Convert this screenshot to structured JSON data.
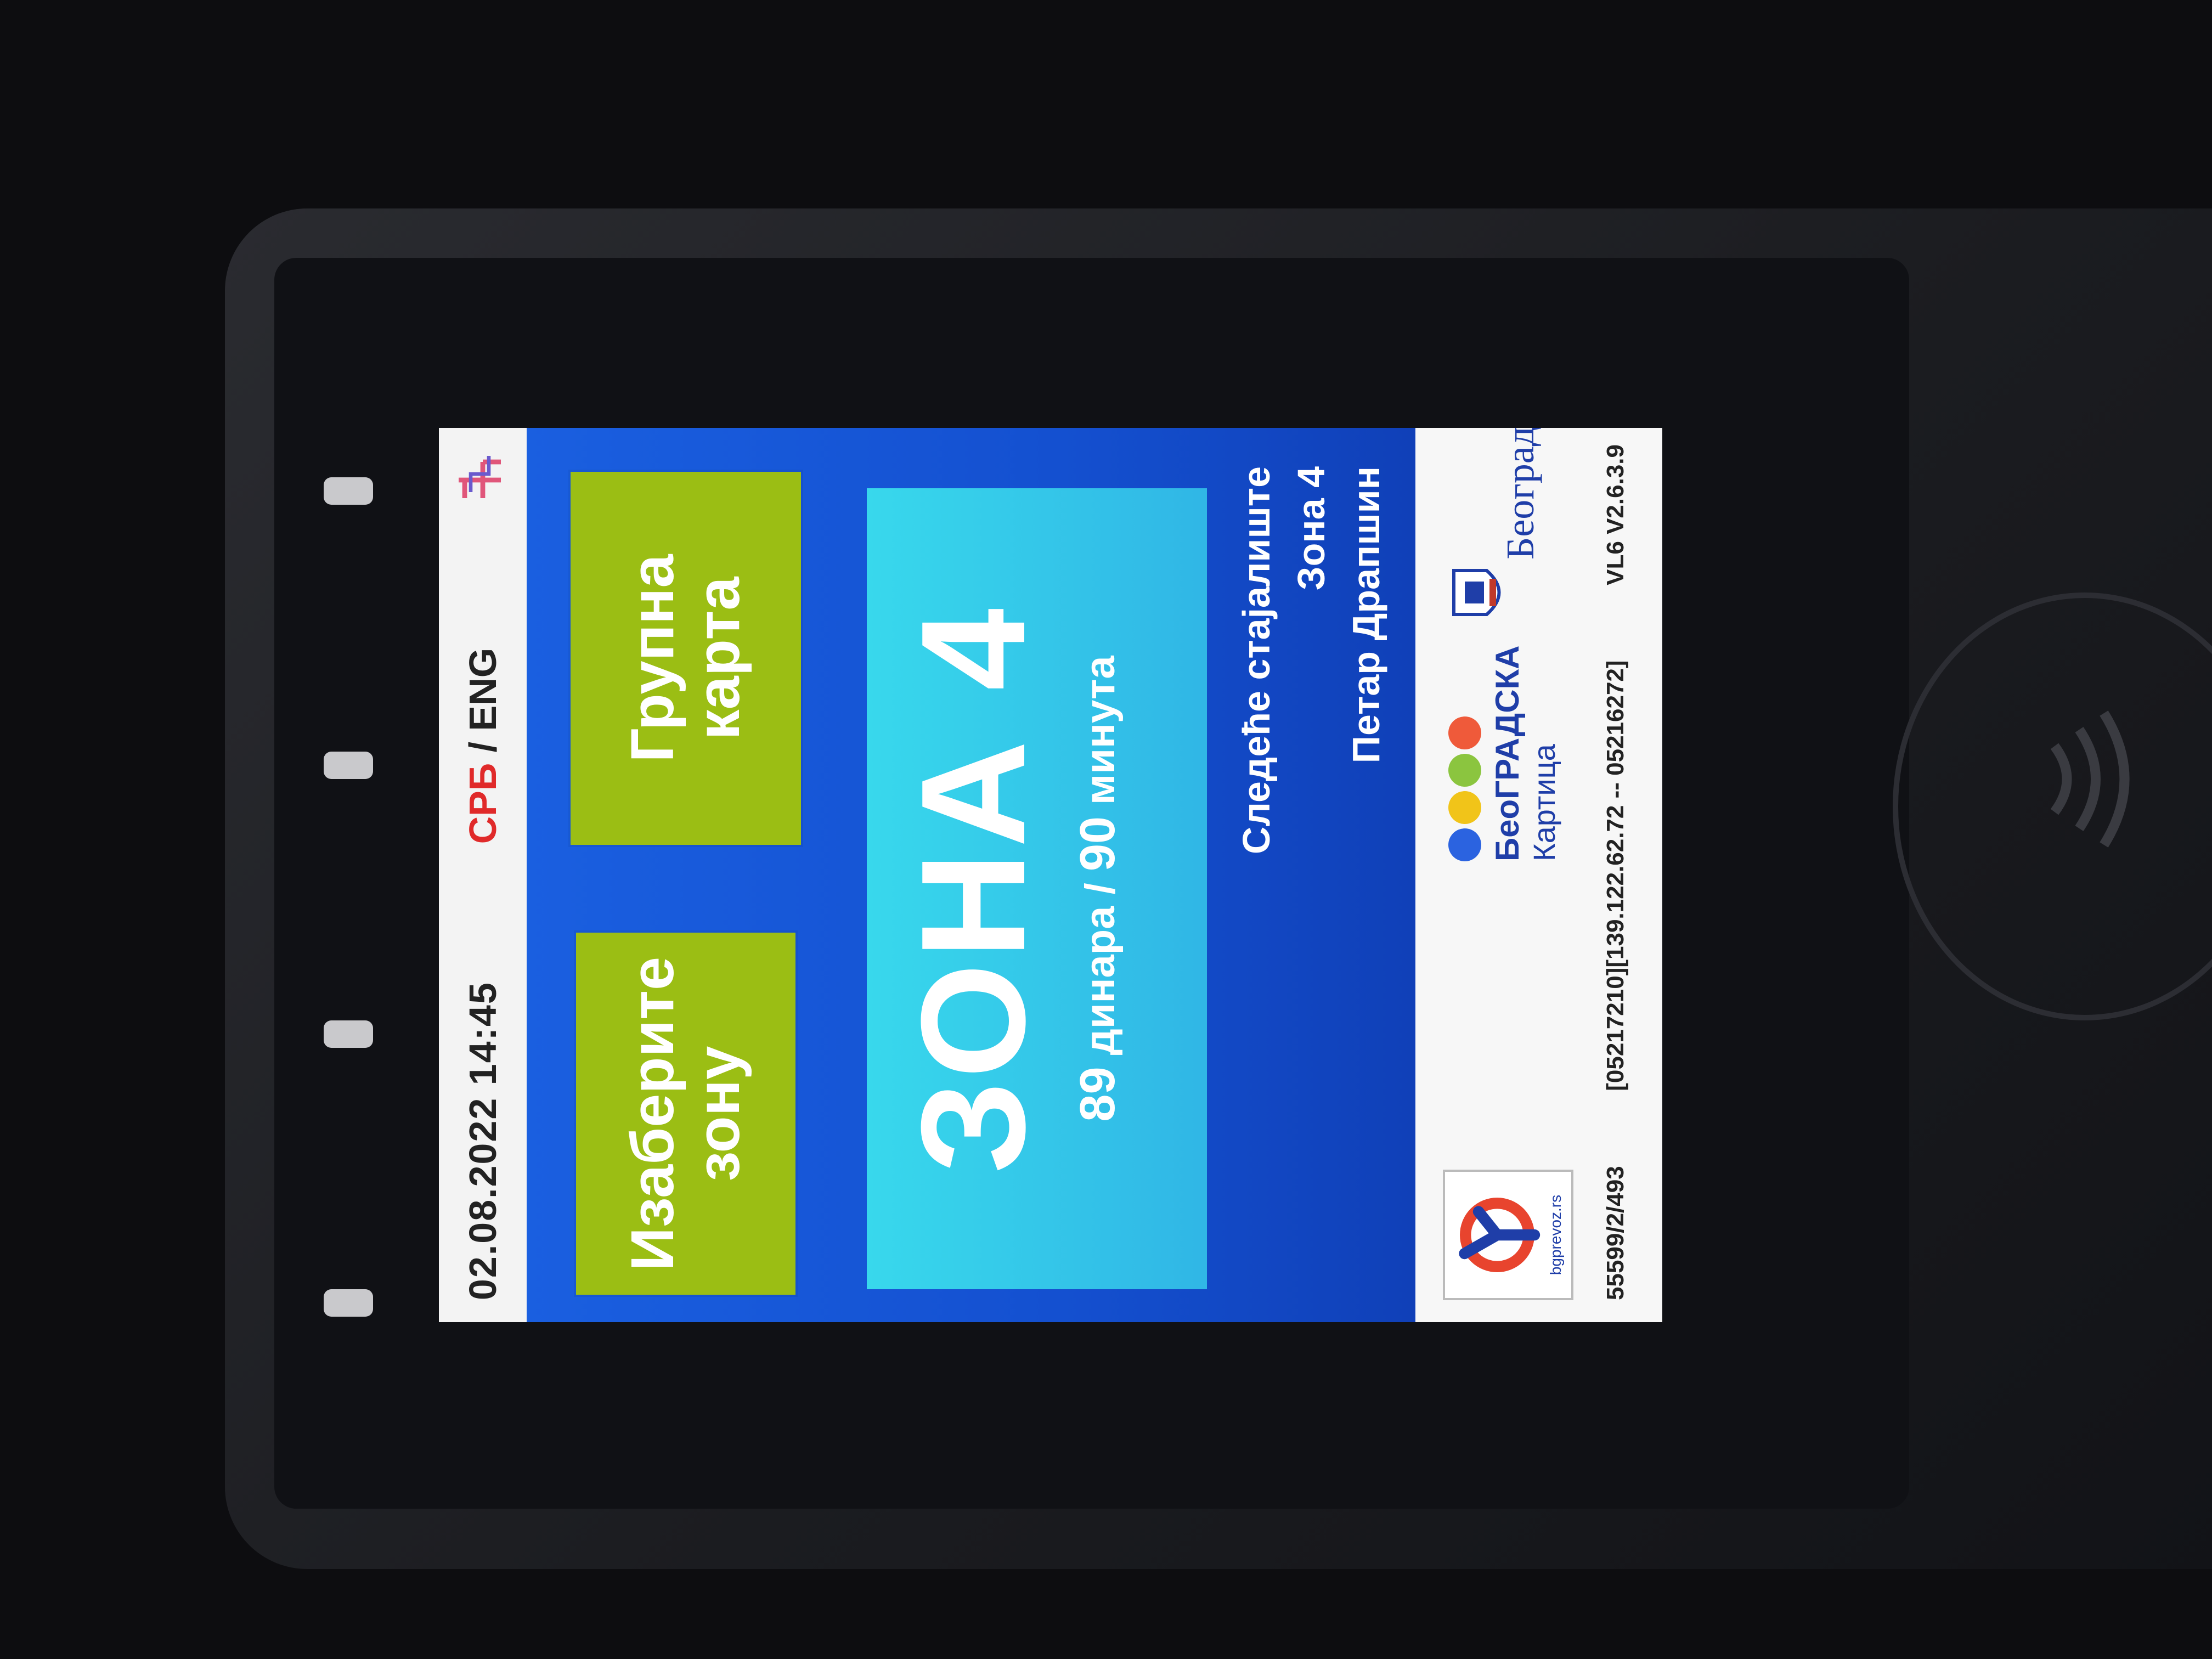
{
  "header": {
    "datetime": "02.08.2022 14:45",
    "lang_active": "СРБ",
    "lang_sep": " / ",
    "lang_other": "ENG"
  },
  "buttons": {
    "choose_zone": "Изаберите\nзону",
    "group_ticket": "Групна\nкарта"
  },
  "zone": {
    "title": "ЗОНА 4",
    "price": "89",
    "price_unit": "динара /",
    "time": "90",
    "time_unit": "минута"
  },
  "next_stop": {
    "label": "Следеће стајалиште",
    "zone": "Зона 4",
    "name": "Петар Драпшин"
  },
  "logos": {
    "bgprevoz": "bgprevoz.rs",
    "beogradska_line1": "БеоГРАДСКА",
    "beogradska_line2": "Картица",
    "beograd": "Београд",
    "dot_colors": [
      "#2b63e0",
      "#f1c419",
      "#8bc53f",
      "#ef5a3a"
    ]
  },
  "footer": {
    "left": "55599/2/493",
    "middle": "[05217210][139.122.62.72 -- 05216272]",
    "right": "VL6 V2.6.3.9"
  },
  "colors": {
    "accent_red": "#e02a2a",
    "screen_blue": "#1a5fe0",
    "button_green": "#9bbe14",
    "zone_cyan": "#38d8ec"
  }
}
